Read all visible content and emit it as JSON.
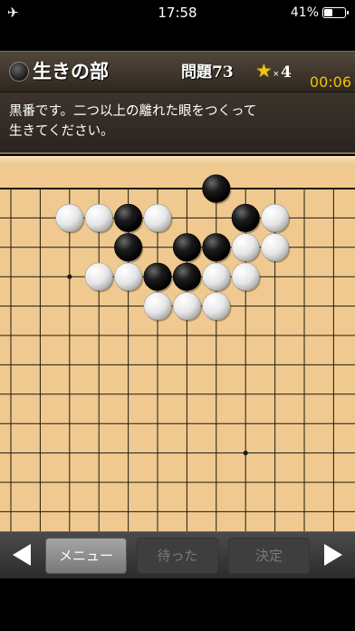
{
  "status_bar": {
    "time": "17:58",
    "battery_percent": "41%",
    "battery_level": 0.41,
    "airplane_icon": "airplane-icon"
  },
  "header": {
    "section_title": "生きの部",
    "problem_label": "問題73",
    "star_symbol": "★",
    "star_multiplier": "×",
    "star_count": "4",
    "timer": "00:06"
  },
  "instruction": {
    "text": "黒番です。二つ以上の離れた眼をつくって\n生きてください。"
  },
  "board": {
    "line_color": "#1f1a12",
    "wood_color": "#efc98f",
    "visible_columns": 12,
    "visible_rows": 12,
    "star_points": [
      [
        2,
        3
      ],
      [
        8,
        3
      ],
      [
        8,
        9
      ]
    ],
    "stones": [
      {
        "col": 7,
        "row": 0,
        "color": "black"
      },
      {
        "col": 2,
        "row": 1,
        "color": "white"
      },
      {
        "col": 3,
        "row": 1,
        "color": "white"
      },
      {
        "col": 4,
        "row": 1,
        "color": "black"
      },
      {
        "col": 5,
        "row": 1,
        "color": "white"
      },
      {
        "col": 8,
        "row": 1,
        "color": "black"
      },
      {
        "col": 9,
        "row": 1,
        "color": "white"
      },
      {
        "col": 4,
        "row": 2,
        "color": "black"
      },
      {
        "col": 6,
        "row": 2,
        "color": "black"
      },
      {
        "col": 7,
        "row": 2,
        "color": "black"
      },
      {
        "col": 8,
        "row": 2,
        "color": "white"
      },
      {
        "col": 9,
        "row": 2,
        "color": "white"
      },
      {
        "col": 3,
        "row": 3,
        "color": "white"
      },
      {
        "col": 4,
        "row": 3,
        "color": "white"
      },
      {
        "col": 5,
        "row": 3,
        "color": "black"
      },
      {
        "col": 6,
        "row": 3,
        "color": "black"
      },
      {
        "col": 7,
        "row": 3,
        "color": "white"
      },
      {
        "col": 8,
        "row": 3,
        "color": "white"
      },
      {
        "col": 5,
        "row": 4,
        "color": "white"
      },
      {
        "col": 6,
        "row": 4,
        "color": "white"
      },
      {
        "col": 7,
        "row": 4,
        "color": "white"
      }
    ]
  },
  "toolbar": {
    "prev_icon": "triangle-left-icon",
    "next_icon": "triangle-right-icon",
    "menu_label": "メニュー",
    "wait_label": "待った",
    "decide_label": "決定"
  }
}
